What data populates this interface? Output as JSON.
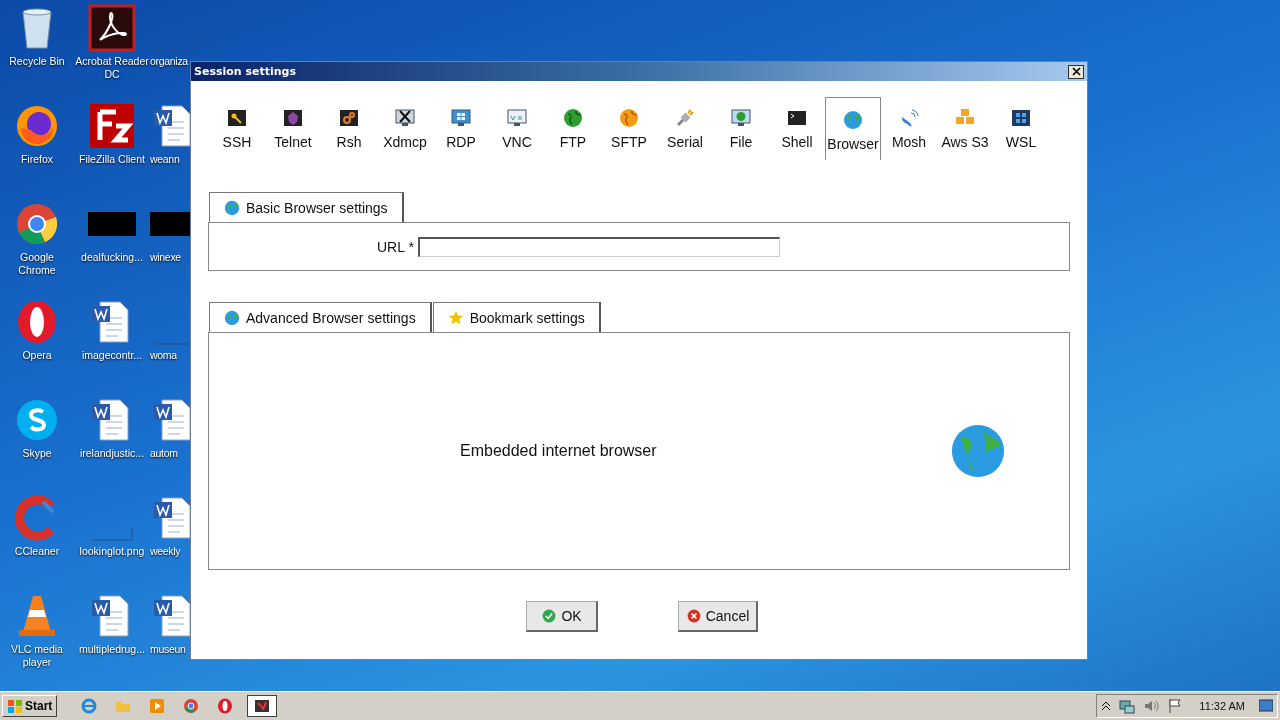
{
  "desktop": {
    "columns": [
      [
        {
          "label": "Recycle Bin",
          "kind": "recycle"
        },
        {
          "label": "Firefox",
          "kind": "firefox"
        },
        {
          "label": "Google Chrome",
          "kind": "chrome"
        },
        {
          "label": "Opera",
          "kind": "opera"
        },
        {
          "label": "Skype",
          "kind": "skype"
        },
        {
          "label": "CCleaner",
          "kind": "ccleaner"
        },
        {
          "label": "VLC media player",
          "kind": "vlc"
        }
      ],
      [
        {
          "label": "Acrobat Reader DC",
          "kind": "acrobat"
        },
        {
          "label": "FileZilla Client",
          "kind": "filezilla"
        },
        {
          "label": "dealfucking...",
          "kind": "black"
        },
        {
          "label": "imagecontr...",
          "kind": "word"
        },
        {
          "label": "irelandjustic...",
          "kind": "word"
        },
        {
          "label": "lookinglot.png",
          "kind": "blank"
        },
        {
          "label": "multipledrug...",
          "kind": "word"
        }
      ],
      [
        {
          "label": "organiza",
          "kind": "blank"
        },
        {
          "label": "weann",
          "kind": "word"
        },
        {
          "label": "winexe",
          "kind": "black"
        },
        {
          "label": "woma",
          "kind": "blank"
        },
        {
          "label": "autom",
          "kind": "word"
        },
        {
          "label": "weekly",
          "kind": "word"
        },
        {
          "label": "museun",
          "kind": "word"
        }
      ]
    ]
  },
  "dialog": {
    "title": "Session settings",
    "session_types": [
      {
        "label": "SSH",
        "kind": "key",
        "selected": false
      },
      {
        "label": "Telnet",
        "kind": "gem",
        "selected": false
      },
      {
        "label": "Rsh",
        "kind": "gears",
        "selected": false
      },
      {
        "label": "Xdmcp",
        "kind": "x-monitor",
        "selected": false
      },
      {
        "label": "RDP",
        "kind": "win-monitor",
        "selected": false
      },
      {
        "label": "VNC",
        "kind": "vnc",
        "selected": false
      },
      {
        "label": "FTP",
        "kind": "green-globe",
        "selected": false
      },
      {
        "label": "SFTP",
        "kind": "orange-globe",
        "selected": false
      },
      {
        "label": "Serial",
        "kind": "plug",
        "selected": false
      },
      {
        "label": "File",
        "kind": "globe-monitor",
        "selected": false
      },
      {
        "label": "Shell",
        "kind": "terminal",
        "selected": false
      },
      {
        "label": "Browser",
        "kind": "globe",
        "selected": true
      },
      {
        "label": "Mosh",
        "kind": "dish",
        "selected": false
      },
      {
        "label": "Aws S3",
        "kind": "cubes",
        "selected": false
      },
      {
        "label": "WSL",
        "kind": "windows",
        "selected": false
      }
    ],
    "basic_tab": {
      "label": "Basic Browser settings",
      "kind": "globe"
    },
    "url_label": "URL *",
    "advanced_tabs": [
      {
        "label": "Advanced Browser settings",
        "kind": "globe"
      },
      {
        "label": "Bookmark settings",
        "kind": "star"
      }
    ],
    "description": "Embedded internet browser",
    "buttons": [
      {
        "label": "OK",
        "kind": "ok"
      },
      {
        "label": "Cancel",
        "kind": "cancel"
      }
    ]
  },
  "taskbar": {
    "start": "Start",
    "apps": [
      {
        "kind": "ie",
        "selected": false
      },
      {
        "kind": "folder",
        "selected": false
      },
      {
        "kind": "media",
        "selected": false
      },
      {
        "kind": "chrome",
        "selected": false
      },
      {
        "kind": "opera",
        "selected": false
      },
      {
        "kind": "terminal-app",
        "selected": true
      }
    ],
    "clock": "11:32 AM"
  }
}
